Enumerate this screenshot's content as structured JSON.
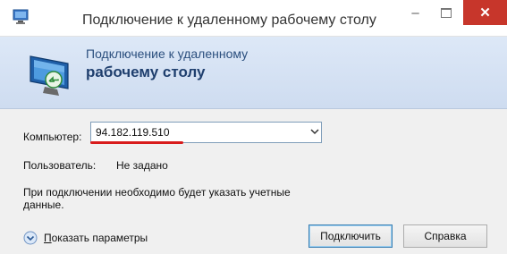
{
  "window": {
    "title": "Подключение к удаленному рабочему столу",
    "controls": {
      "minimize": "–",
      "close": "✕"
    }
  },
  "header": {
    "line1": "Подключение к удаленному",
    "line2": "рабочему столу",
    "icon": "remote-desktop-monitor-icon"
  },
  "form": {
    "computer_label": "Компьютер:",
    "computer_value": "94.182.119.510",
    "user_label": "Пользователь:",
    "user_value": "Не задано",
    "hint": "При подключении необходимо будет указать учетные данные."
  },
  "footer": {
    "options_first_letter": "П",
    "options_rest": "оказать параметры",
    "connect_label": "Подключить",
    "help_label": "Справка"
  },
  "colors": {
    "close_button": "#c7362b",
    "header_text": "#1f3f6e",
    "annotation_underline": "#d81c1c"
  }
}
